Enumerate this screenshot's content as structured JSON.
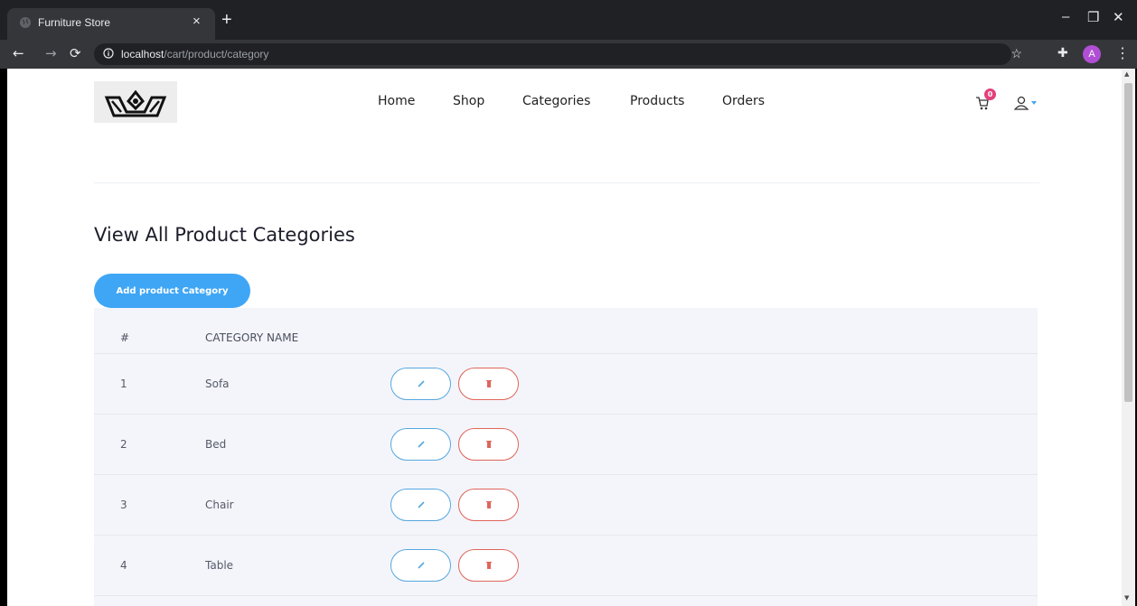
{
  "browser": {
    "tab_title": "Furniture Store",
    "tab_close": "×",
    "new_tab": "+",
    "url_host": "localhost",
    "url_path": "/cart/product/category",
    "profile_initial": "A",
    "window_controls": [
      "–",
      "❐",
      "✕"
    ]
  },
  "nav": {
    "items": [
      "Home",
      "Shop",
      "Categories",
      "Products",
      "Orders"
    ]
  },
  "cart": {
    "count": "0"
  },
  "page": {
    "title": "View All Product Categories",
    "add_button": "Add product Category"
  },
  "table": {
    "headers": [
      "#",
      "CATEGORY NAME"
    ],
    "rows": [
      {
        "num": "1",
        "name": "Sofa"
      },
      {
        "num": "2",
        "name": "Bed"
      },
      {
        "num": "3",
        "name": "Chair"
      },
      {
        "num": "4",
        "name": "Table"
      }
    ]
  },
  "colors": {
    "accent": "#3fa6f5",
    "edit_border": "#55a7de",
    "delete_border": "#e0655a",
    "badge": "#e4407b"
  }
}
